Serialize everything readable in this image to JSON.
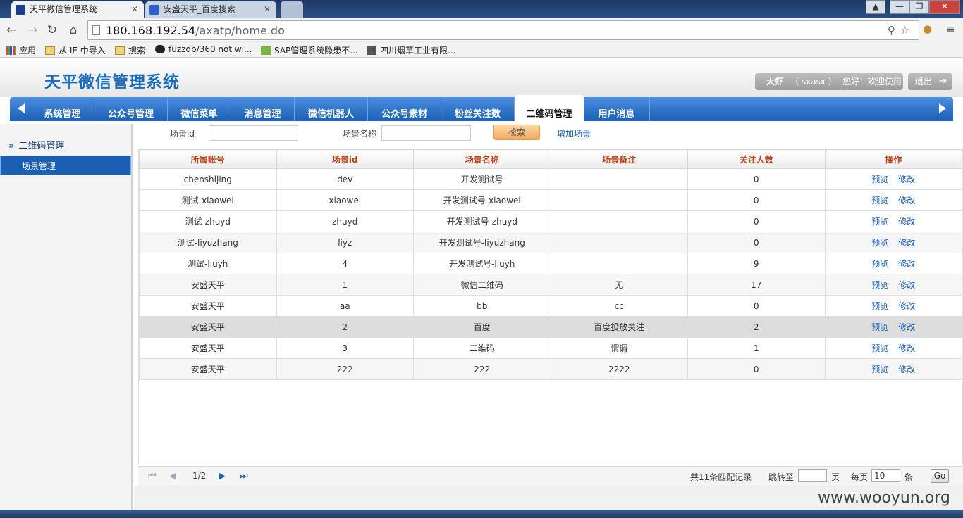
{
  "browser": {
    "tabs": [
      {
        "label": "天平微信管理系统",
        "active": true
      },
      {
        "label": "安盛天平_百度搜索",
        "active": false
      }
    ],
    "url_host": "180.168.192.54",
    "url_path": "/axatp/home.do",
    "bookmarks": [
      "应用",
      "从 IE 中导入",
      "搜索",
      "fuzzdb/360 not wi...",
      "SAP管理系统隐患不...",
      "四川烟草工业有限..."
    ]
  },
  "header": {
    "title": "天平微信管理系统",
    "user_name": "大虾",
    "user_id": "（ sxasx ）",
    "welcome": "您好！欢迎使用",
    "logout": "退出"
  },
  "nav": {
    "items": [
      "系统管理",
      "公众号管理",
      "微信菜单",
      "消息管理",
      "微信机器人",
      "公众号素材",
      "粉丝关注数",
      "二维码管理",
      "用户消息"
    ],
    "active_index": 7
  },
  "sidebar": {
    "group": "二维码管理",
    "item": "场景管理"
  },
  "search": {
    "scene_id_label": "场景id",
    "scene_name_label": "场景名称",
    "search_button": "检索",
    "add_link": "增加场景"
  },
  "table": {
    "columns": [
      "所属账号",
      "场景id",
      "场景名称",
      "场景备注",
      "关注人数",
      "操作"
    ],
    "rows": [
      [
        "chenshijing",
        "dev",
        "开发测试号",
        "",
        "0"
      ],
      [
        "测试-xiaowei",
        "xiaowei",
        "开发测试号-xiaowei",
        "",
        "0"
      ],
      [
        "测试-zhuyd",
        "zhuyd",
        "开发测试号-zhuyd",
        "",
        "0"
      ],
      [
        "测试-liyuzhang",
        "liyz",
        "开发测试号-liyuzhang",
        "",
        "0"
      ],
      [
        "测试-liuyh",
        "4",
        "开发测试号-liuyh",
        "",
        "9"
      ],
      [
        "安盛天平",
        "1",
        "微信二维码",
        "无",
        "17"
      ],
      [
        "安盛天平",
        "aa",
        "bb",
        "cc",
        "0"
      ],
      [
        "安盛天平",
        "2",
        "百度",
        "百度投放关注",
        "2"
      ],
      [
        "安盛天平",
        "3",
        "二维码",
        "谓谓",
        "1"
      ],
      [
        "安盛天平",
        "222",
        "222",
        "2222",
        "0"
      ]
    ],
    "action_preview": "预览",
    "action_edit": "修改"
  },
  "pager": {
    "page": "1/2",
    "total": "共11条匹配记录",
    "jump_label": "跳转至",
    "page_unit": "页",
    "per_page_label": "每页",
    "per_page_value": "10",
    "per_page_unit": "条",
    "go": "Go"
  },
  "watermark": "www.wooyun.org",
  "colors": {
    "nav_blue": "#1b5fb4",
    "title_blue": "#1b6bbd",
    "header_text_red": "#b5451e",
    "search_orange": "#f3a85f"
  }
}
